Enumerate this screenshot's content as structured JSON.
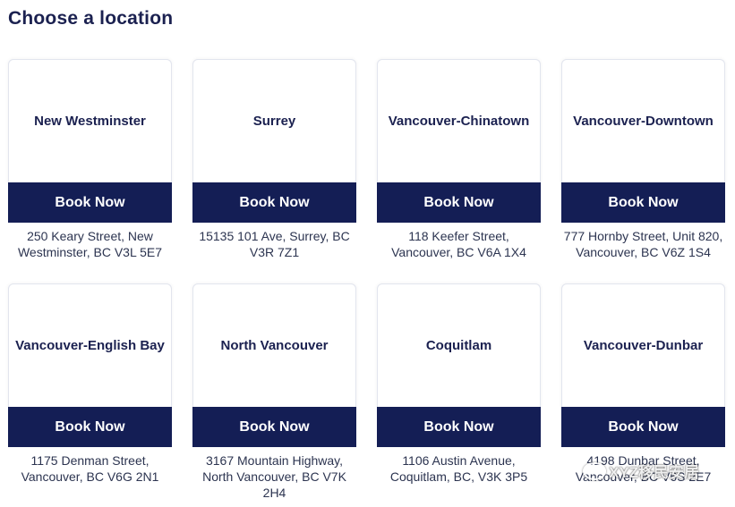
{
  "page": {
    "title": "Choose a location"
  },
  "locations": [
    {
      "name": "New Westminster",
      "button": "Book Now",
      "address": "250 Keary Street, New Westminster, BC V3L 5E7"
    },
    {
      "name": "Surrey",
      "button": "Book Now",
      "address": "15135 101 Ave, Surrey, BC V3R 7Z1"
    },
    {
      "name": "Vancouver-Chinatown",
      "button": "Book Now",
      "address": "118 Keefer Street, Vancouver, BC V6A 1X4"
    },
    {
      "name": "Vancouver-Downtown",
      "button": "Book Now",
      "address": "777 Hornby Street, Unit 820, Vancouver, BC V6Z 1S4"
    },
    {
      "name": "Vancouver-English Bay",
      "button": "Book Now",
      "address": "1175 Denman Street, Vancouver, BC V6G 2N1"
    },
    {
      "name": "North Vancouver",
      "button": "Book Now",
      "address": "3167 Mountain Highway, North Vancouver, BC V7K 2H4"
    },
    {
      "name": "Coquitlam",
      "button": "Book Now",
      "address": "1106 Austin Avenue, Coquitlam, BC, V3K 3P5"
    },
    {
      "name": "Vancouver-Dunbar",
      "button": "Book Now",
      "address": "4198 Dunbar Street, Vancouver, BC V6S 2E7"
    }
  ],
  "watermark": {
    "text": "XYZ移民安居",
    "icon": "wechat-icon"
  },
  "colors": {
    "primary": "#141e55",
    "text": "#1b2150"
  }
}
